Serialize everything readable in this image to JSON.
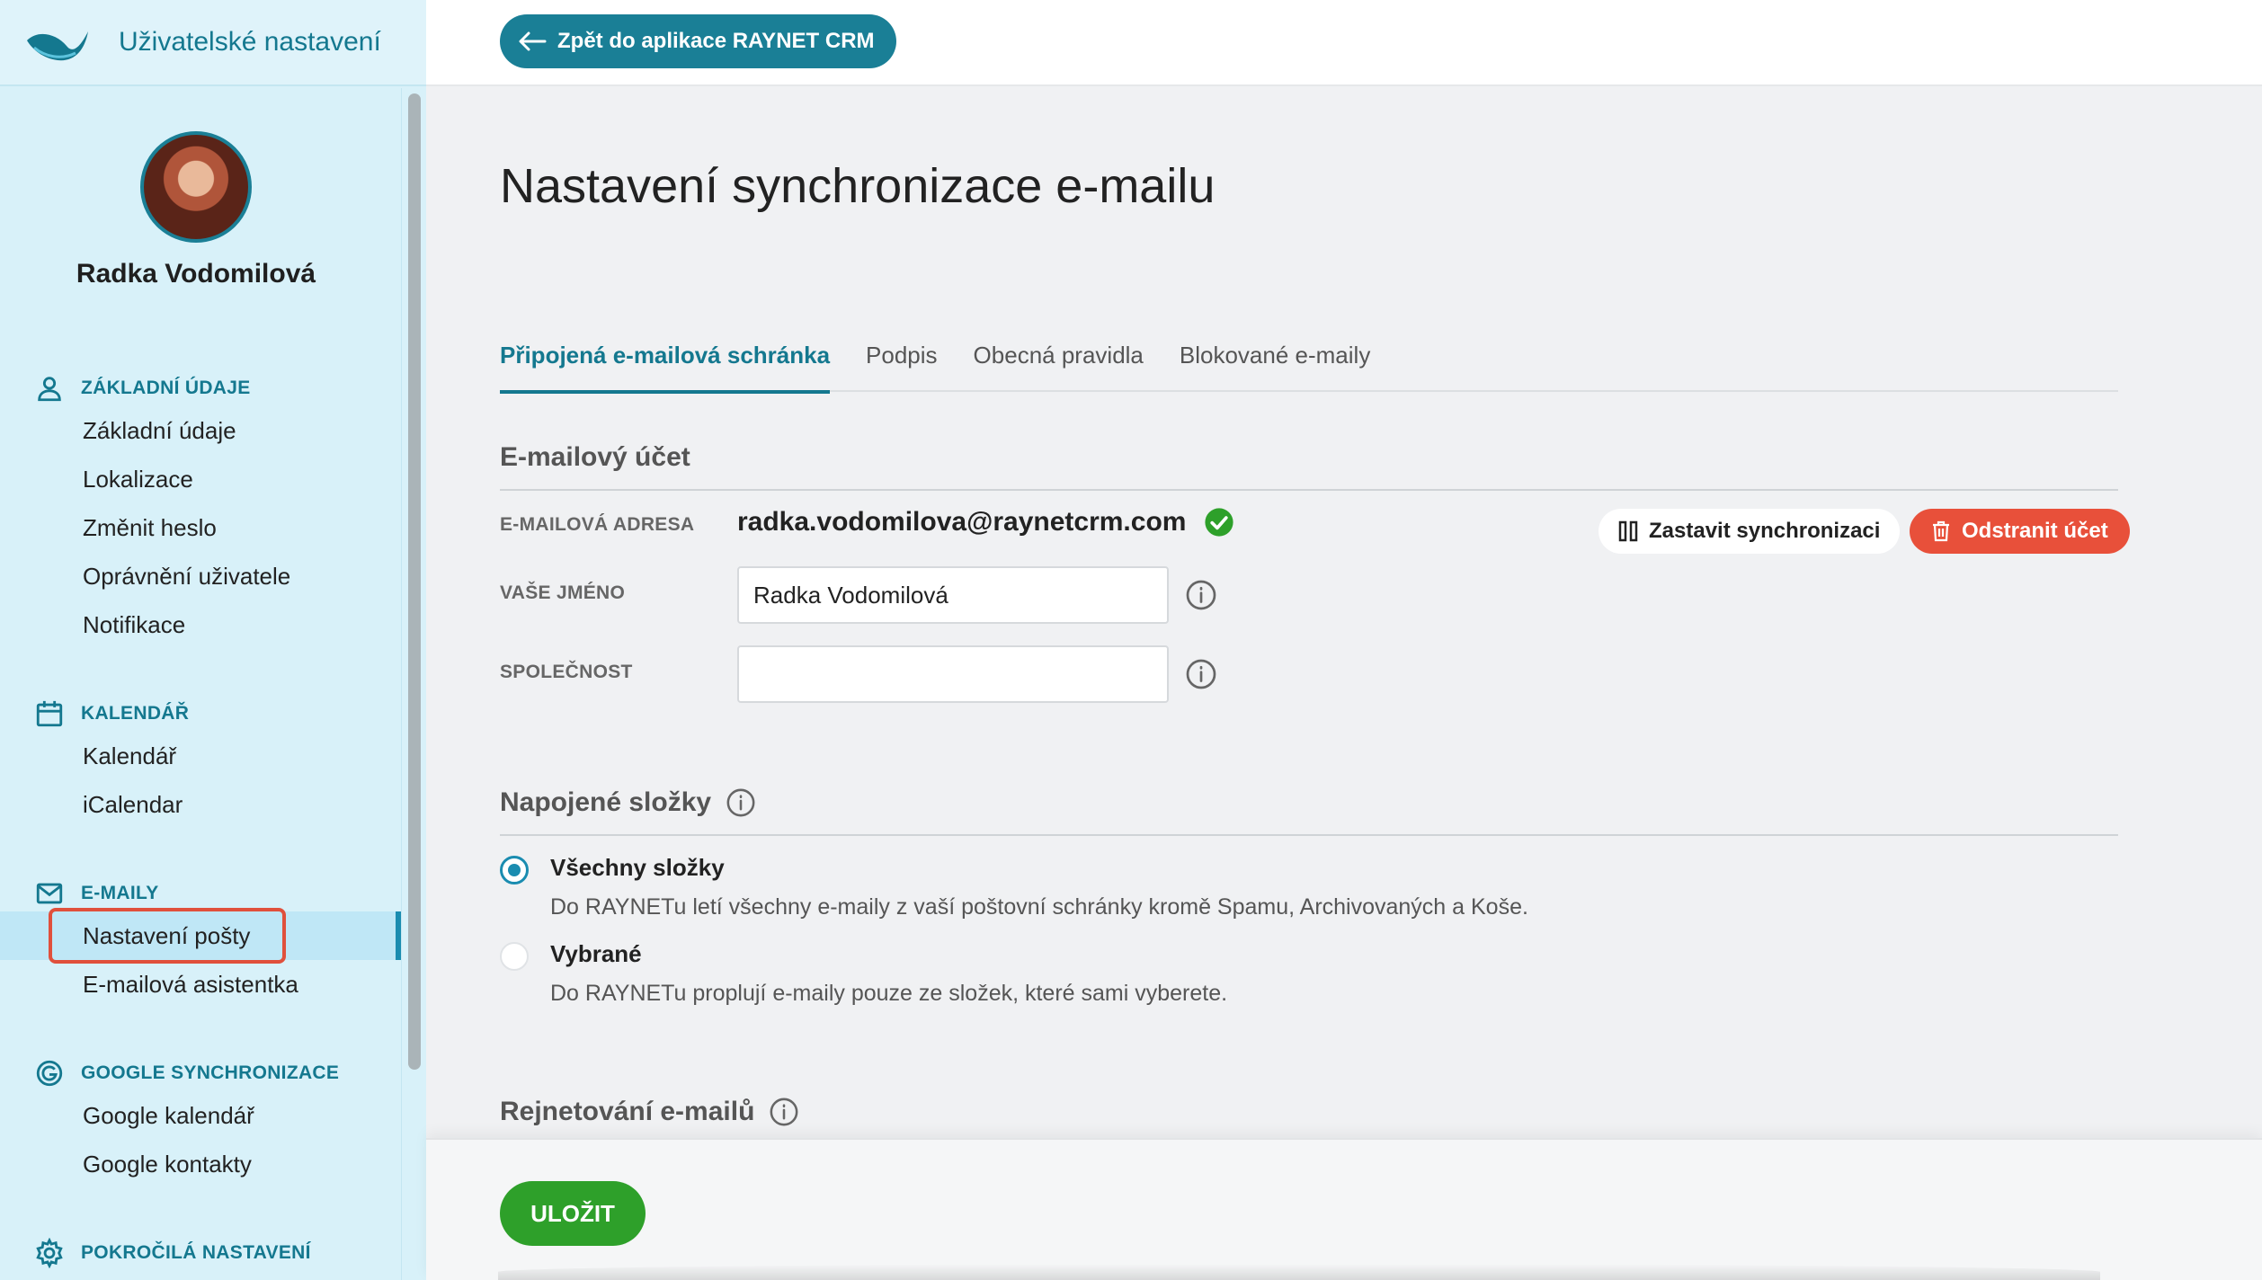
{
  "sidebar": {
    "title": "Uživatelské nastavení",
    "user_name": "Radka Vodomilová",
    "sections": [
      {
        "label": "ZÁKLADNÍ ÚDAJE",
        "icon": "user-icon",
        "items": [
          "Základní údaje",
          "Lokalizace",
          "Změnit heslo",
          "Oprávnění uživatele",
          "Notifikace"
        ]
      },
      {
        "label": "KALENDÁŘ",
        "icon": "calendar-icon",
        "items": [
          "Kalendář",
          "iCalendar"
        ]
      },
      {
        "label": "E-MAILY",
        "icon": "mail-icon",
        "items": [
          "Nastavení pošty",
          "E-mailová asistentka"
        ]
      },
      {
        "label": "GOOGLE SYNCHRONIZACE",
        "icon": "google-icon",
        "items": [
          "Google kalendář",
          "Google kontakty"
        ]
      },
      {
        "label": "POKROČILÁ NASTAVENÍ",
        "icon": "gear-icon",
        "items": []
      }
    ]
  },
  "topbar": {
    "back_label": "Zpět do aplikace RAYNET CRM"
  },
  "main": {
    "title": "Nastavení synchronizace e-mailu",
    "tabs": [
      "Připojená e-mailová schránka",
      "Podpis",
      "Obecná pravidla",
      "Blokované e-maily"
    ],
    "account": {
      "heading": "E-mailový účet",
      "email_label": "E-MAILOVÁ ADRESA",
      "email_value": "radka.vodomilova@raynetcrm.com",
      "name_label": "VAŠE JMÉNO",
      "name_value": "Radka Vodomilová",
      "company_label": "SPOLEČNOST",
      "company_value": "",
      "stop_label": "Zastavit synchronizaci",
      "delete_label": "Odstranit účet"
    },
    "folders": {
      "heading": "Napojené složky",
      "options": [
        {
          "title": "Všechny složky",
          "desc": "Do RAYNETu letí všechny e-maily z vaší poštovní schránky kromě Spamu, Archivovaných a Koše."
        },
        {
          "title": "Vybrané",
          "desc": "Do RAYNETu proplují e-maily pouze ze složek, které sami vyberete."
        }
      ]
    },
    "rejection": {
      "heading": "Rejnetování e-mailů"
    }
  },
  "footer": {
    "save_label": "ULOŽIT"
  },
  "colors": {
    "accent": "#1a7f96",
    "delete": "#e8503a",
    "save": "#2ea02a",
    "highlight": "#e0503c"
  }
}
